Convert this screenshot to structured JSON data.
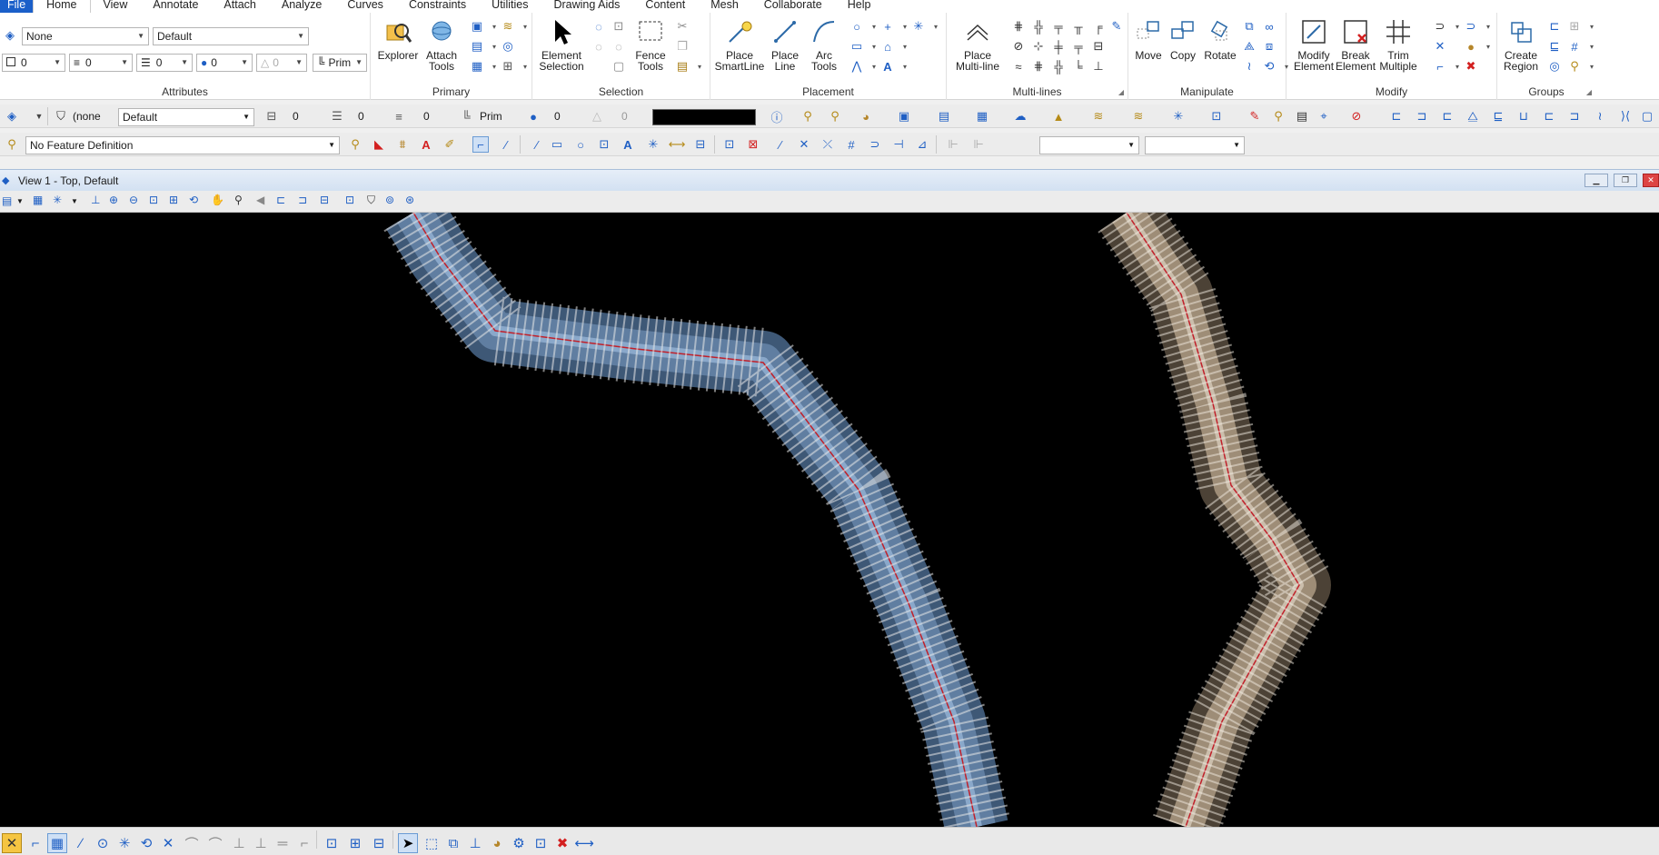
{
  "menu": {
    "items": [
      "File",
      "Home",
      "View",
      "Annotate",
      "Attach",
      "Analyze",
      "Curves",
      "Constraints",
      "Utilities",
      "Drawing Aids",
      "Content",
      "Mesh",
      "Collaborate",
      "Help"
    ]
  },
  "ribbon": {
    "attributes": {
      "label": "Attributes",
      "level": "None",
      "style": "Default",
      "color": "0",
      "weight": "0",
      "transparency": "0",
      "priority": "0",
      "class": "Prim"
    },
    "primary": {
      "label": "Primary",
      "explorer": "Explorer",
      "attach_tools": "Attach Tools"
    },
    "selection": {
      "label": "Selection",
      "element_selection": "Element Selection",
      "fence_tools": "Fence Tools"
    },
    "placement": {
      "label": "Placement",
      "place_smartline": "Place SmartLine",
      "place_line": "Place Line",
      "arc_tools": "Arc Tools"
    },
    "multilines": {
      "label": "Multi-lines",
      "place_multiline": "Place Multi-line"
    },
    "manipulate": {
      "label": "Manipulate",
      "move": "Move",
      "copy": "Copy",
      "rotate": "Rotate"
    },
    "modify": {
      "label": "Modify",
      "modify_element": "Modify Element",
      "break_element": "Break Element",
      "trim_multiple": "Trim Multiple"
    },
    "groups": {
      "label": "Groups",
      "create_region": "Create Region"
    }
  },
  "toolbar1": {
    "filter_label": "(none",
    "style_value": "Default",
    "color_value": "0",
    "weight_value": "0",
    "line_value": "0",
    "class_value": "Prim",
    "level_value": "0",
    "transparency_value": "0"
  },
  "toolbar2": {
    "feature_definition": "No Feature Definition"
  },
  "view": {
    "title": "View 1 - Top, Default"
  },
  "colors": {
    "accent": "#1a5fc9",
    "canvas": "#000000",
    "road_left": "#6f8fb4",
    "road_right": "#b9a78e",
    "centerline": "#c0202a"
  }
}
